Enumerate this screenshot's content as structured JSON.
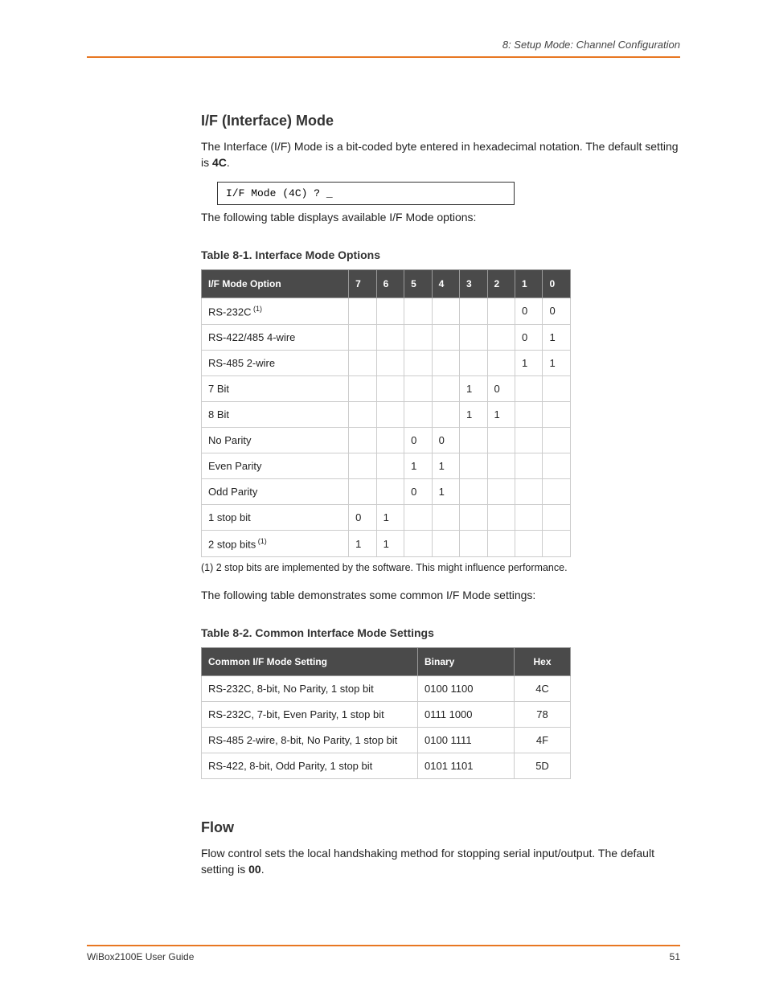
{
  "header": {
    "right_text": "8: Setup Mode: Channel Configuration"
  },
  "section1": {
    "heading": "I/F (Interface) Mode",
    "para_prefix": "The Interface (I/F) Mode is a bit-coded byte entered in hexadecimal notation. The default setting is ",
    "para_bold": "4C",
    "code_box": "I/F Mode (4C) ? _",
    "post_text": "The following table displays available I/F Mode options:"
  },
  "table1": {
    "title": "Table 8-1. Interface Mode Options",
    "headers": [
      "I/F Mode Option",
      "7",
      "6",
      "5",
      "4",
      "3",
      "2",
      "1",
      "0"
    ],
    "rows": [
      {
        "label": "RS-232C",
        "sup": "(1)",
        "cells": [
          "",
          "",
          "",
          "",
          "",
          "",
          "0",
          "0"
        ]
      },
      {
        "label": "RS-422/485 4-wire",
        "cells": [
          "",
          "",
          "",
          "",
          "",
          "",
          "0",
          "1"
        ]
      },
      {
        "label": "RS-485 2-wire",
        "cells": [
          "",
          "",
          "",
          "",
          "",
          "",
          "1",
          "1"
        ]
      },
      {
        "label": "7 Bit",
        "cells": [
          "",
          "",
          "",
          "",
          "1",
          "0",
          "",
          ""
        ]
      },
      {
        "label": "8 Bit",
        "cells": [
          "",
          "",
          "",
          "",
          "1",
          "1",
          "",
          ""
        ]
      },
      {
        "label": "No Parity",
        "cells": [
          "",
          "",
          "0",
          "0",
          "",
          "",
          "",
          ""
        ]
      },
      {
        "label": "Even Parity",
        "cells": [
          "",
          "",
          "1",
          "1",
          "",
          "",
          "",
          ""
        ]
      },
      {
        "label": "Odd Parity",
        "cells": [
          "",
          "",
          "0",
          "1",
          "",
          "",
          "",
          ""
        ]
      },
      {
        "label": "1 stop bit",
        "cells": [
          "0",
          "1",
          "",
          "",
          "",
          "",
          "",
          ""
        ]
      },
      {
        "label": "2 stop bits",
        "sup": "(1)",
        "cells": [
          "1",
          "1",
          "",
          "",
          "",
          "",
          "",
          ""
        ]
      }
    ]
  },
  "footnote1": "(1) 2 stop bits are implemented by the software. This might influence performance.",
  "between_tables": "The following table demonstrates some common I/F Mode settings:",
  "table2": {
    "title": "Table 8-2. Common Interface Mode Settings",
    "headers": [
      "Common I/F Mode Setting",
      "Binary",
      "Hex"
    ],
    "rows": [
      {
        "setting": "RS-232C, 8-bit, No Parity, 1 stop bit",
        "binary": "0100 1100",
        "hex": "4C"
      },
      {
        "setting": "RS-232C, 7-bit, Even Parity, 1 stop bit",
        "binary": "0111 1000",
        "hex": "78"
      },
      {
        "setting": "RS-485 2-wire, 8-bit, No Parity, 1 stop bit",
        "binary": "0100 1111",
        "hex": "4F"
      },
      {
        "setting": "RS-422, 8-bit, Odd Parity, 1 stop bit",
        "binary": "0101 1101",
        "hex": "5D"
      }
    ]
  },
  "section2": {
    "heading": "Flow",
    "para_prefix": "Flow control sets the local handshaking method for stopping serial input/output. The default setting is ",
    "para_bold": "00"
  },
  "footer": {
    "left": "WiBox2100E User Guide",
    "right": "51"
  }
}
